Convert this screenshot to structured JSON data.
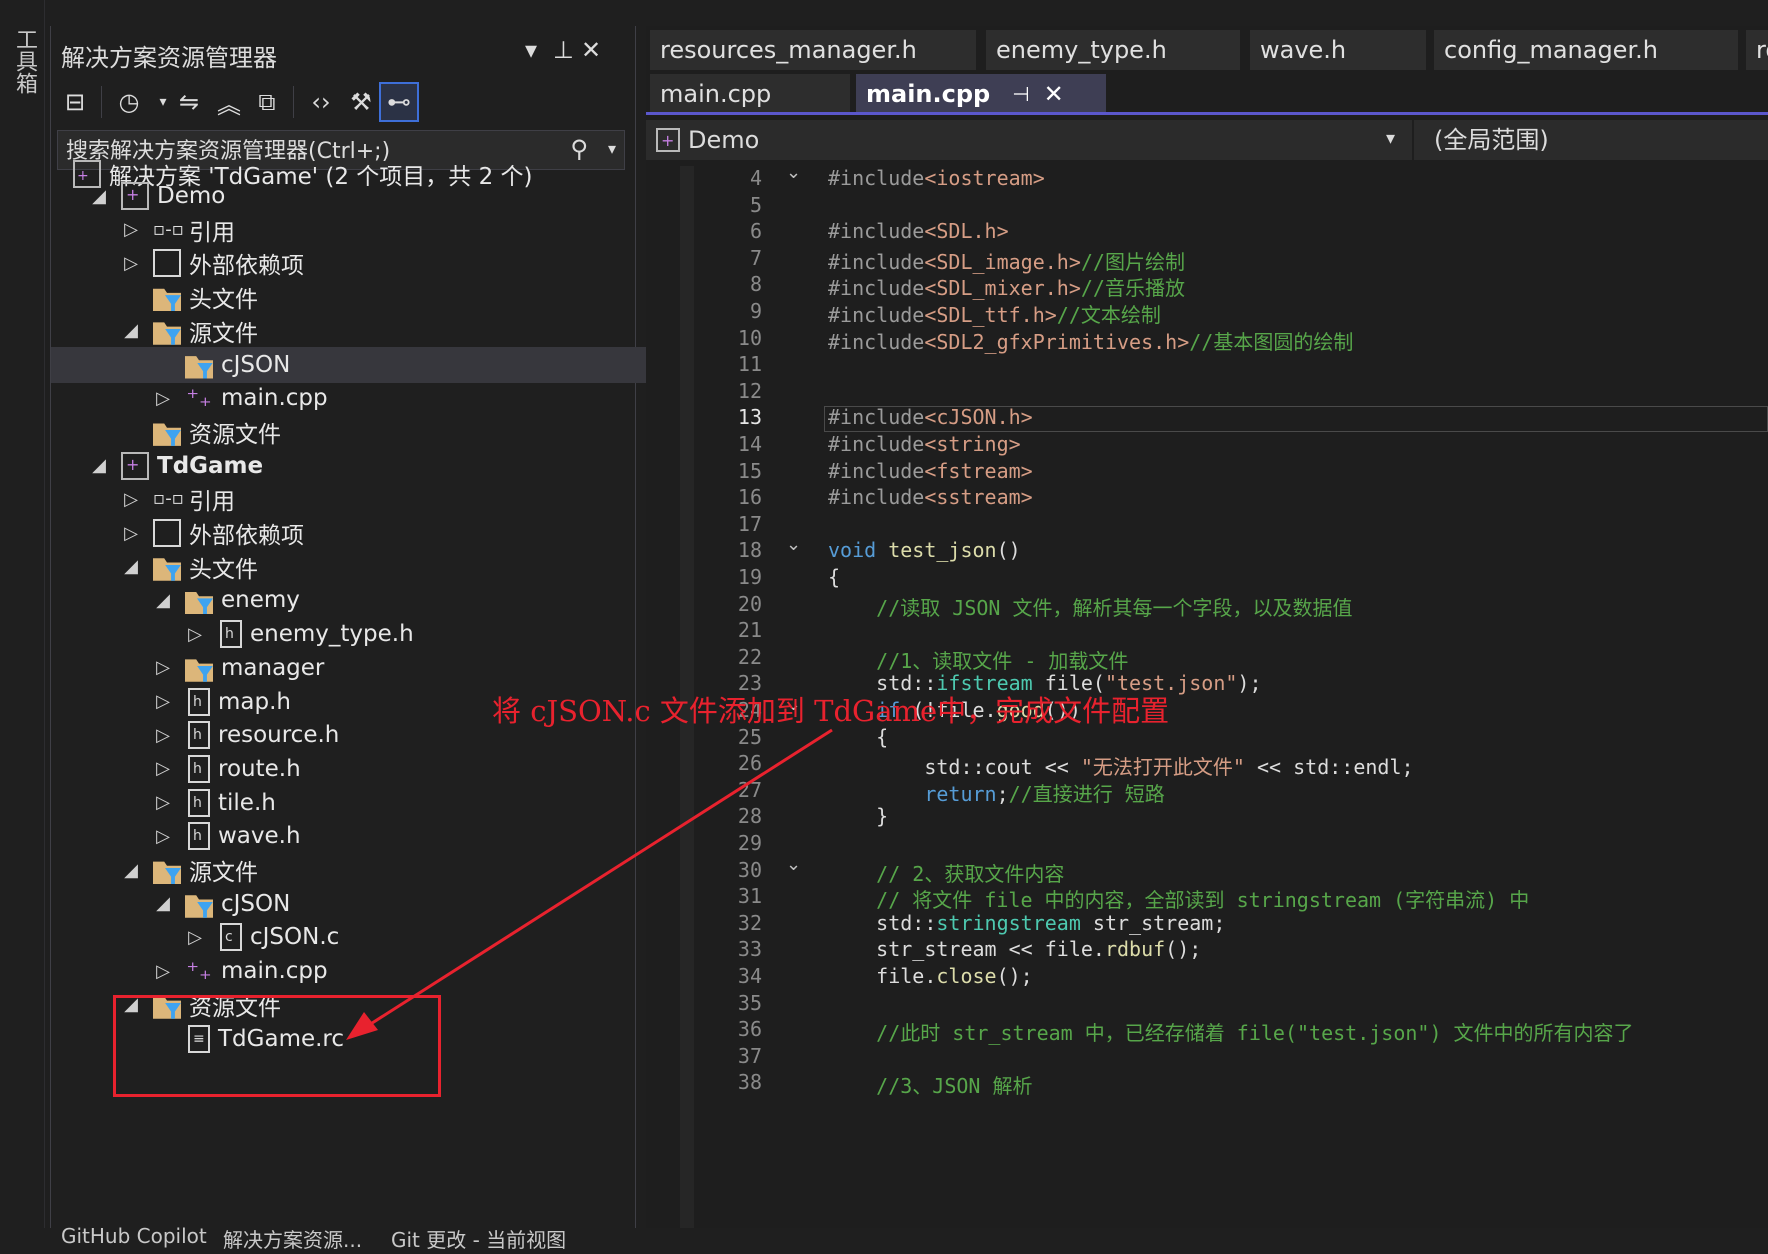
{
  "toolbox": {
    "label": "工具箱"
  },
  "solution_explorer": {
    "title": "解决方案资源管理器",
    "search_placeholder": "搜索解决方案资源管理器(Ctrl+;)",
    "solution": "解决方案 'TdGame' (2 个项目，共 2 个)",
    "tree": [
      {
        "label": "Demo",
        "expander": "◢",
        "icon": "project"
      },
      {
        "label": "引用",
        "expander": "▷",
        "icon": "reference"
      },
      {
        "label": "外部依赖项",
        "expander": "▷",
        "icon": "external"
      },
      {
        "label": "头文件",
        "expander": "",
        "icon": "filter-folder"
      },
      {
        "label": "源文件",
        "expander": "◢",
        "icon": "filter-folder"
      },
      {
        "label": "cJSON",
        "expander": "",
        "icon": "filter-folder",
        "selected": true
      },
      {
        "label": "main.cpp",
        "expander": "▷",
        "icon": "cpp"
      },
      {
        "label": "资源文件",
        "expander": "",
        "icon": "filter-folder"
      },
      {
        "label": "TdGame",
        "expander": "◢",
        "icon": "project",
        "bold": true
      },
      {
        "label": "引用",
        "expander": "▷",
        "icon": "reference"
      },
      {
        "label": "外部依赖项",
        "expander": "▷",
        "icon": "external"
      },
      {
        "label": "头文件",
        "expander": "◢",
        "icon": "filter-folder"
      },
      {
        "label": "enemy",
        "expander": "◢",
        "icon": "filter-folder"
      },
      {
        "label": "enemy_type.h",
        "expander": "▷",
        "icon": "h"
      },
      {
        "label": "manager",
        "expander": "▷",
        "icon": "filter-folder"
      },
      {
        "label": "map.h",
        "expander": "▷",
        "icon": "h"
      },
      {
        "label": "resource.h",
        "expander": "▷",
        "icon": "h"
      },
      {
        "label": "route.h",
        "expander": "▷",
        "icon": "h"
      },
      {
        "label": "tile.h",
        "expander": "▷",
        "icon": "h"
      },
      {
        "label": "wave.h",
        "expander": "▷",
        "icon": "h"
      },
      {
        "label": "源文件",
        "expander": "◢",
        "icon": "filter-folder"
      },
      {
        "label": "cJSON",
        "expander": "◢",
        "icon": "filter-folder"
      },
      {
        "label": "cJSON.c",
        "expander": "▷",
        "icon": "c"
      },
      {
        "label": "main.cpp",
        "expander": "▷",
        "icon": "cpp"
      },
      {
        "label": "资源文件",
        "expander": "◢",
        "icon": "filter-folder"
      },
      {
        "label": "TdGame.rc",
        "expander": "",
        "icon": "rc"
      }
    ],
    "bottom_tabs": [
      "GitHub Copilot",
      "解决方案资源...",
      "Git 更改 - 当前视图"
    ]
  },
  "editor": {
    "tabs_row1": [
      "resources_manager.h",
      "enemy_type.h",
      "wave.h",
      "config_manager.h",
      "ro"
    ],
    "tabs_row2": [
      "main.cpp",
      "main.cpp"
    ],
    "project": "Demo",
    "scope": "(全局范围)",
    "current_line": "13",
    "lines": [
      {
        "n": "4",
        "fold": "⌄",
        "segs": [
          [
            "pp",
            "#include"
          ],
          [
            "inc",
            "<iostream>"
          ]
        ]
      },
      {
        "n": "5",
        "segs": []
      },
      {
        "n": "6",
        "segs": [
          [
            "pp",
            "#include"
          ],
          [
            "inc",
            "<SDL.h>"
          ]
        ]
      },
      {
        "n": "7",
        "segs": [
          [
            "pp",
            "#include"
          ],
          [
            "inc",
            "<SDL_image.h>"
          ],
          [
            "cm",
            "//图片绘制"
          ]
        ]
      },
      {
        "n": "8",
        "segs": [
          [
            "pp",
            "#include"
          ],
          [
            "inc",
            "<SDL_mixer.h>"
          ],
          [
            "cm",
            "//音乐播放"
          ]
        ]
      },
      {
        "n": "9",
        "segs": [
          [
            "pp",
            "#include"
          ],
          [
            "inc",
            "<SDL_ttf.h>"
          ],
          [
            "cm",
            "//文本绘制"
          ]
        ]
      },
      {
        "n": "10",
        "segs": [
          [
            "pp",
            "#include"
          ],
          [
            "inc",
            "<SDL2_gfxPrimitives.h>"
          ],
          [
            "cm",
            "//基本图圆的绘制"
          ]
        ]
      },
      {
        "n": "11",
        "segs": []
      },
      {
        "n": "12",
        "segs": []
      },
      {
        "n": "13",
        "segs": [
          [
            "pp",
            "#include"
          ],
          [
            "inc",
            "<cJSON.h>"
          ]
        ]
      },
      {
        "n": "14",
        "segs": [
          [
            "pp",
            "#include"
          ],
          [
            "inc",
            "<string>"
          ]
        ]
      },
      {
        "n": "15",
        "segs": [
          [
            "pp",
            "#include"
          ],
          [
            "inc",
            "<fstream>"
          ]
        ]
      },
      {
        "n": "16",
        "segs": [
          [
            "pp",
            "#include"
          ],
          [
            "inc",
            "<sstream>"
          ]
        ]
      },
      {
        "n": "17",
        "segs": []
      },
      {
        "n": "18",
        "fold": "⌄",
        "segs": [
          [
            "kw",
            "void "
          ],
          [
            "fn",
            "test_json"
          ],
          [
            "",
            "()"
          ]
        ]
      },
      {
        "n": "19",
        "segs": [
          [
            "",
            "{"
          ]
        ]
      },
      {
        "n": "20",
        "segs": [
          [
            "",
            "    "
          ],
          [
            "cm",
            "//读取 JSON 文件，解析其每一个字段，以及数据值"
          ]
        ]
      },
      {
        "n": "21",
        "segs": []
      },
      {
        "n": "22",
        "segs": [
          [
            "",
            "    "
          ],
          [
            "cm",
            "//1、读取文件 - 加载文件"
          ]
        ]
      },
      {
        "n": "23",
        "segs": [
          [
            "",
            "    std::"
          ],
          [
            "ty",
            "ifstream "
          ],
          [
            "",
            "file("
          ],
          [
            "str",
            "\"test.json\""
          ],
          [
            "",
            ");"
          ]
        ]
      },
      {
        "n": "24",
        "fold": "⌄",
        "segs": [
          [
            "",
            "    "
          ],
          [
            "kw",
            "if "
          ],
          [
            "",
            "(!file."
          ],
          [
            "fn",
            "good"
          ],
          [
            "",
            "())"
          ]
        ]
      },
      {
        "n": "25",
        "segs": [
          [
            "",
            "    {"
          ]
        ]
      },
      {
        "n": "26",
        "segs": [
          [
            "",
            "        std::cout << "
          ],
          [
            "str",
            "\"无法打开此文件\""
          ],
          [
            "",
            " << std::endl;"
          ]
        ]
      },
      {
        "n": "27",
        "segs": [
          [
            "",
            "        "
          ],
          [
            "kw",
            "return"
          ],
          [
            "",
            ";"
          ],
          [
            "cm",
            "//直接进行 短路"
          ]
        ]
      },
      {
        "n": "28",
        "segs": [
          [
            "",
            "    }"
          ]
        ]
      },
      {
        "n": "29",
        "segs": []
      },
      {
        "n": "30",
        "fold": "⌄",
        "segs": [
          [
            "",
            "    "
          ],
          [
            "cm",
            "// 2、获取文件内容"
          ]
        ]
      },
      {
        "n": "31",
        "segs": [
          [
            "",
            "    "
          ],
          [
            "cm",
            "// 将文件 file 中的内容，全部读到 stringstream (字符串流) 中"
          ]
        ]
      },
      {
        "n": "32",
        "segs": [
          [
            "",
            "    std::"
          ],
          [
            "ty",
            "stringstream "
          ],
          [
            "",
            "str_stream;"
          ]
        ]
      },
      {
        "n": "33",
        "segs": [
          [
            "",
            "    str_stream << file."
          ],
          [
            "fn",
            "rdbuf"
          ],
          [
            "",
            "();"
          ]
        ]
      },
      {
        "n": "34",
        "segs": [
          [
            "",
            "    file."
          ],
          [
            "fn",
            "close"
          ],
          [
            "",
            "();"
          ]
        ]
      },
      {
        "n": "35",
        "segs": []
      },
      {
        "n": "36",
        "segs": [
          [
            "",
            "    "
          ],
          [
            "cm",
            "//此时 str_stream 中，已经存储着 file(\"test.json\") 文件中的所有内容了"
          ]
        ]
      },
      {
        "n": "37",
        "segs": []
      },
      {
        "n": "38",
        "segs": [
          [
            "",
            "    "
          ],
          [
            "cm",
            "//3、JSON 解析"
          ]
        ]
      }
    ]
  },
  "annotation": {
    "text": "将 cJSON.c 文件添加到 TdGame中，完成文件配置",
    "color": "#e8222e"
  },
  "colors": {
    "accent": "#5b57cc",
    "highlight": "#e8222e",
    "folder": "#dcb67a",
    "filter": "#3ea3f0"
  }
}
